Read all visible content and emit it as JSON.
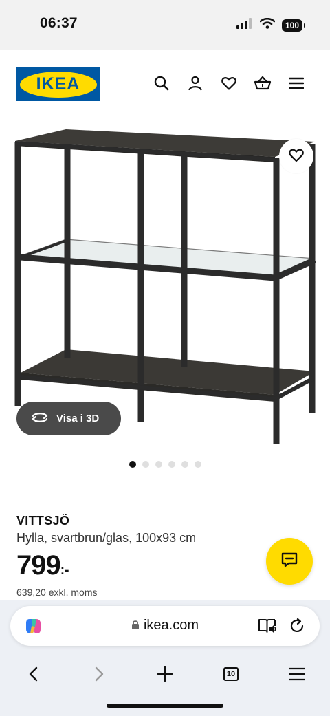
{
  "status_bar": {
    "time": "06:37",
    "battery": "100",
    "icons": [
      "signal-icon",
      "wifi-icon",
      "battery-icon"
    ]
  },
  "header": {
    "logo_text": "IKEA",
    "icons": [
      "search-icon",
      "account-icon",
      "heart-icon",
      "basket-icon",
      "menu-icon"
    ]
  },
  "gallery": {
    "view_3d_label": "Visa i 3D",
    "image_count": 6,
    "active_index": 0
  },
  "product": {
    "name": "VITTSJÖ",
    "description": "Hylla, svartbrun/glas,",
    "dimensions": "100x93 cm",
    "price": "799",
    "price_suffix": ":-",
    "price_excl_vat": "639,20 exkl. moms"
  },
  "browser": {
    "url": "ikea.com",
    "tab_count": "10",
    "nav_icons": [
      "back-icon",
      "forward-icon",
      "new-tab-icon",
      "tabs-icon",
      "menu-icon"
    ]
  },
  "colors": {
    "ikea_blue": "#0058a3",
    "ikea_yellow": "#ffdb00",
    "frame_color": "#2b2b2b",
    "button_dark": "#4a4a4a"
  }
}
